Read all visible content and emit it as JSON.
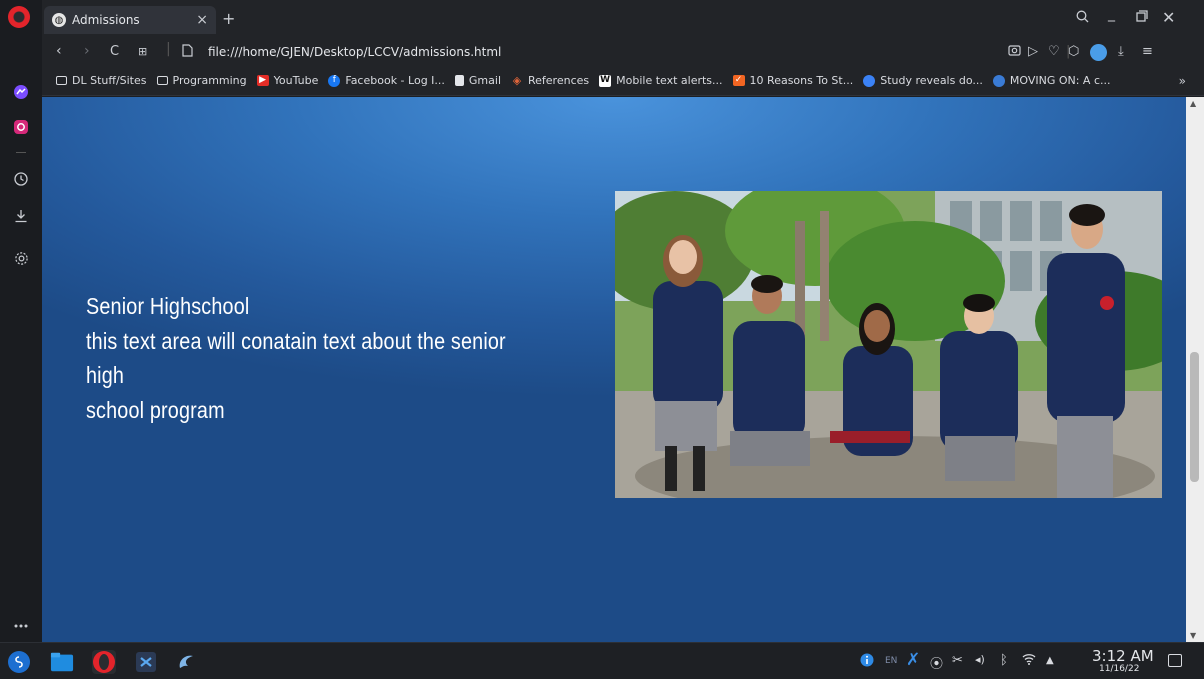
{
  "browser": {
    "tab_title": "Admissions",
    "tab_close": "×",
    "new_tab": "+",
    "url": "file:///home/GJEN/Desktop/LCCV/admissions.html",
    "bookmarks": [
      {
        "label": "DL Stuff/Sites",
        "icon": "folder-icon",
        "color": "#d9dbe0"
      },
      {
        "label": "Programming",
        "icon": "folder-icon",
        "color": "#d9dbe0"
      },
      {
        "label": "YouTube",
        "icon": "youtube-icon",
        "color": "#e52d27"
      },
      {
        "label": "Facebook - Log I...",
        "icon": "facebook-icon",
        "color": "#1877f2"
      },
      {
        "label": "Gmail",
        "icon": "document-icon",
        "color": "#e4e6ea"
      },
      {
        "label": "References",
        "icon": "references-icon",
        "color": "#e0653a"
      },
      {
        "label": "Mobile text alerts...",
        "icon": "w-icon",
        "color": "#ffffff"
      },
      {
        "label": "10 Reasons To St...",
        "icon": "checkmark-icon",
        "color": "#f26522"
      },
      {
        "label": "Study reveals do...",
        "icon": "study-icon",
        "color": "#3b82f6"
      },
      {
        "label": "MOVING ON: A c...",
        "icon": "moving-on-icon",
        "color": "#3a7bd5"
      }
    ],
    "bookmarks_more": "»"
  },
  "page": {
    "hero_lines": [
      "Senior Highschool",
      "this text area will conatain text about the senior high",
      "school program"
    ],
    "background_color": "#2b66ad",
    "photo": "students-group-photo"
  },
  "taskbar": {
    "clock_time": "3:12 AM",
    "clock_date": "11/16/22",
    "language": "EN"
  }
}
